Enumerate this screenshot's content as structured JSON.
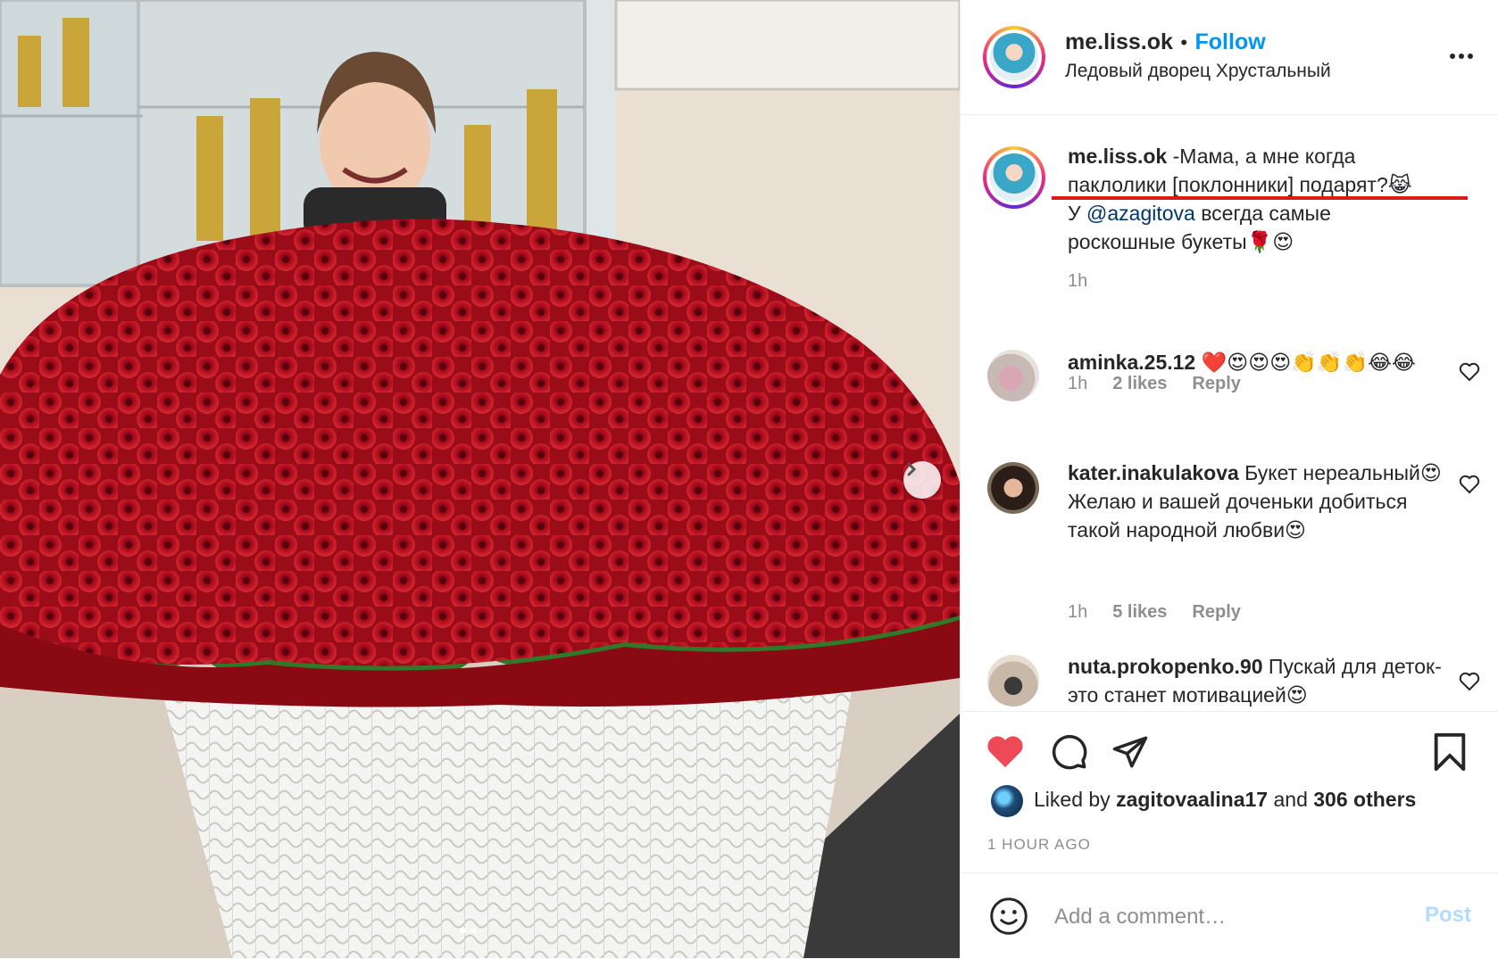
{
  "post": {
    "author": "me.liss.ok",
    "follow_label": "Follow",
    "separator": "•",
    "location": "Ледовый дворец Хрустальный"
  },
  "caption": {
    "username": "me.liss.ok",
    "text_part1": " -Мама, а мне когда паклолики [поклонники] подарят?😹",
    "text_part2": "У ",
    "mention": "@azagitova",
    "text_part3": " всегда самые роскошные букеты🌹😍",
    "time": "1h"
  },
  "comments": [
    {
      "username": "aminka.25.12",
      "text": " ❤️😍😍😍👏👏👏😂😂",
      "time": "1h",
      "likes": "2 likes",
      "reply": "Reply"
    },
    {
      "username": "kater.inakulakova",
      "text": " Букет нереальный😍Желаю и вашей доченьки добиться такой народной любви😍",
      "time": "1h",
      "likes": "5 likes",
      "reply": "Reply"
    },
    {
      "username": "nuta.prokopenko.90",
      "text": " Пускай для деток-это станет мотивацией😍"
    }
  ],
  "liked_by": {
    "prefix": "Liked by ",
    "user": "zagitovaalina17",
    "middle": " and ",
    "count": "306 others"
  },
  "timestamp": "1 HOUR AGO",
  "add_comment": {
    "placeholder": "Add a comment…",
    "post_label": "Post"
  },
  "colors": {
    "accent": "#0095f6",
    "like_red": "#ed4956",
    "annotation_red": "#e01818"
  }
}
